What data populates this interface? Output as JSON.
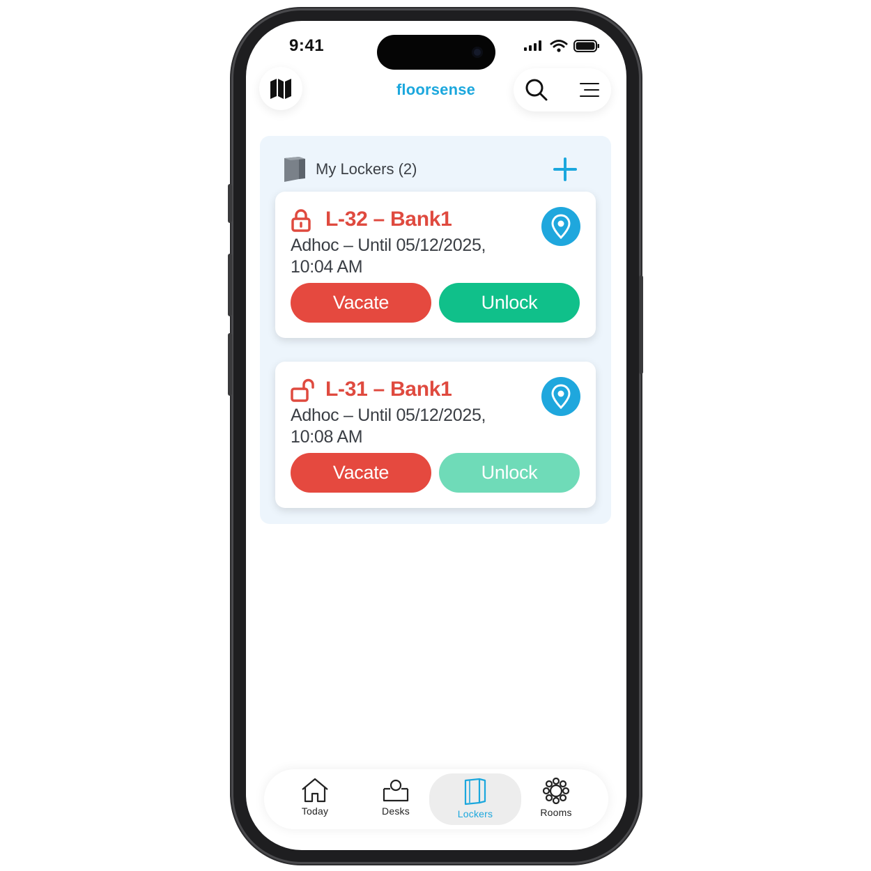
{
  "status_bar": {
    "time": "9:41"
  },
  "header": {
    "brand": "floorsense"
  },
  "lockers": {
    "title": "My Lockers (2)",
    "items": [
      {
        "title": "L-32 – Bank1",
        "detail": "Adhoc – Until 05/12/2025, 10:04 AM",
        "state": "locked",
        "vacate_label": "Vacate",
        "unlock_label": "Unlock",
        "unlock_enabled": true
      },
      {
        "title": "L-31 – Bank1",
        "detail": "Adhoc – Until 05/12/2025, 10:08 AM",
        "state": "unlocked",
        "vacate_label": "Vacate",
        "unlock_label": "Unlock",
        "unlock_enabled": false
      }
    ]
  },
  "nav": {
    "items": [
      {
        "label": "Today",
        "icon": "home-icon"
      },
      {
        "label": "Desks",
        "icon": "desk-icon"
      },
      {
        "label": "Lockers",
        "icon": "locker-icon",
        "active": true
      },
      {
        "label": "Rooms",
        "icon": "rooms-icon"
      }
    ]
  },
  "colors": {
    "accent": "#1ba7dd",
    "danger": "#e5493f",
    "success": "#10c08a",
    "success_disabled": "#6fdbb8",
    "panel_bg": "#edf5fc"
  }
}
